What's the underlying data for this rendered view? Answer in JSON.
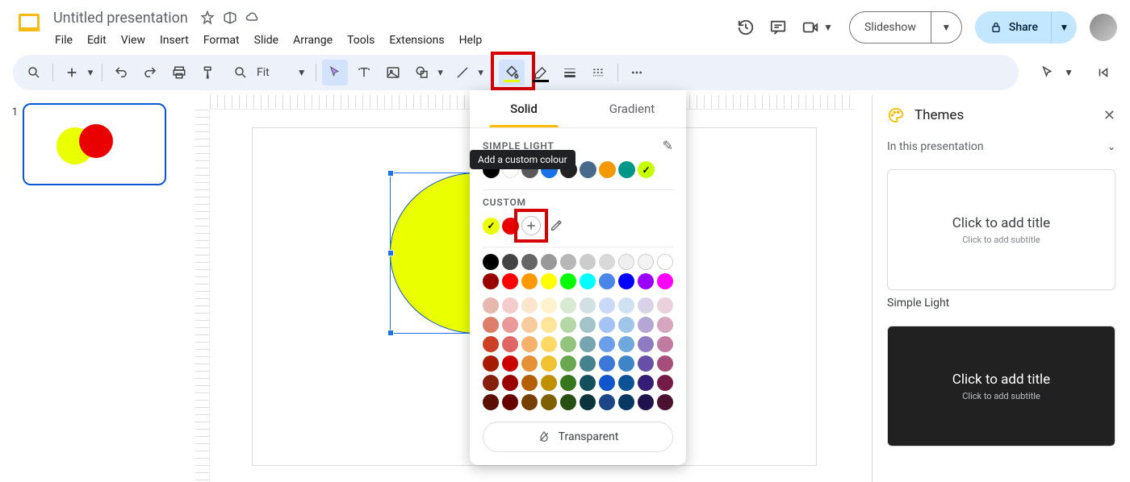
{
  "header": {
    "title": "Untitled presentation",
    "menus": [
      "File",
      "Edit",
      "View",
      "Insert",
      "Format",
      "Slide",
      "Arrange",
      "Tools",
      "Extensions",
      "Help"
    ],
    "slideshow_label": "Slideshow",
    "share_label": "Share"
  },
  "toolbar": {
    "zoom_label": "Fit"
  },
  "slides_panel": {
    "slide_number": "1"
  },
  "color_popup": {
    "tabs": {
      "solid": "Solid",
      "gradient": "Gradient"
    },
    "theme_label": "SIMPLE LIGHT",
    "theme_colors": [
      "#000000",
      "#ffffff",
      "#595959",
      "#1a73e8",
      "#212121",
      "#476a8a",
      "#f29900",
      "#009688",
      "#c6ff00"
    ],
    "theme_selected_index": 8,
    "custom_label": "CUSTOM",
    "custom_colors": [
      "#eaff00",
      "#ea0000"
    ],
    "custom_selected_index": 0,
    "add_tooltip": "Add a custom colour",
    "palette_row1": [
      "#000000",
      "#434343",
      "#666666",
      "#999999",
      "#b7b7b7",
      "#cccccc",
      "#d9d9d9",
      "#efefef",
      "#f3f3f3",
      "#ffffff"
    ],
    "palette_row2": [
      "#980000",
      "#ff0000",
      "#ff9900",
      "#ffff00",
      "#00ff00",
      "#00ffff",
      "#4a86e8",
      "#0000ff",
      "#9900ff",
      "#ff00ff"
    ],
    "palette_light1": [
      "#e6b8af",
      "#f4cccc",
      "#fce5cd",
      "#fff2cc",
      "#d9ead3",
      "#d0e0e3",
      "#c9daf8",
      "#cfe2f3",
      "#d9d2e9",
      "#ead1dc"
    ],
    "palette_light2": [
      "#dd7e6b",
      "#ea9999",
      "#f9cb9c",
      "#ffe599",
      "#b6d7a8",
      "#a2c4c9",
      "#a4c2f4",
      "#9fc5e8",
      "#b4a7d6",
      "#d5a6bd"
    ],
    "palette_mid": [
      "#cc4125",
      "#e06666",
      "#f6b26b",
      "#ffd966",
      "#93c47d",
      "#76a5af",
      "#6d9eeb",
      "#6fa8dc",
      "#8e7cc3",
      "#c27ba0"
    ],
    "palette_dark1": [
      "#a61c00",
      "#cc0000",
      "#e69138",
      "#f1c232",
      "#6aa84f",
      "#45818e",
      "#3c78d8",
      "#3d85c6",
      "#674ea7",
      "#a64d79"
    ],
    "palette_dark2": [
      "#85200c",
      "#990000",
      "#b45f06",
      "#bf9000",
      "#38761d",
      "#134f5c",
      "#1155cc",
      "#0b5394",
      "#351c75",
      "#741b47"
    ],
    "palette_dark3": [
      "#5b0f00",
      "#660000",
      "#783f04",
      "#7f6000",
      "#274e13",
      "#0c343d",
      "#1c4587",
      "#073763",
      "#20124d",
      "#4c1130"
    ],
    "transparent_label": "Transparent"
  },
  "themes": {
    "title": "Themes",
    "subtitle": "In this presentation",
    "card1": {
      "title": "Click to add title",
      "sub": "Click to add subtitle",
      "name": "Simple Light"
    },
    "card2": {
      "title": "Click to add title",
      "sub": "Click to add subtitle"
    }
  }
}
